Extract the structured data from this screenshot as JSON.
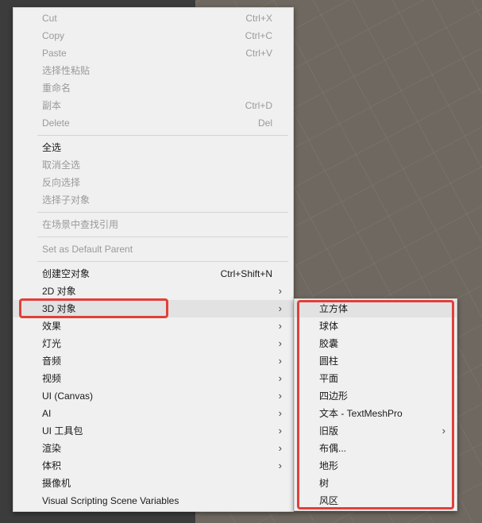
{
  "main_menu": {
    "group1": [
      {
        "label": "Cut",
        "shortcut": "Ctrl+X",
        "disabled": true
      },
      {
        "label": "Copy",
        "shortcut": "Ctrl+C",
        "disabled": true
      },
      {
        "label": "Paste",
        "shortcut": "Ctrl+V",
        "disabled": true
      },
      {
        "label": "选择性粘贴",
        "shortcut": "",
        "disabled": true
      },
      {
        "label": "重命名",
        "shortcut": "",
        "disabled": true
      },
      {
        "label": "副本",
        "shortcut": "Ctrl+D",
        "disabled": true
      },
      {
        "label": "Delete",
        "shortcut": "Del",
        "disabled": true
      }
    ],
    "group2": [
      {
        "label": "全选",
        "disabled": false
      },
      {
        "label": "取消全选",
        "disabled": true
      },
      {
        "label": "反向选择",
        "disabled": true
      },
      {
        "label": "选择子对象",
        "disabled": true
      }
    ],
    "group3": [
      {
        "label": "在场景中查找引用",
        "disabled": true
      }
    ],
    "group4": [
      {
        "label": "Set as Default Parent",
        "disabled": true
      }
    ],
    "group5": [
      {
        "label": "创建空对象",
        "shortcut": "Ctrl+Shift+N",
        "arrow": false
      },
      {
        "label": "2D 对象",
        "shortcut": "",
        "arrow": true
      },
      {
        "label": "3D 对象",
        "shortcut": "",
        "arrow": true,
        "highlighted": true
      },
      {
        "label": "效果",
        "shortcut": "",
        "arrow": true
      },
      {
        "label": "灯光",
        "shortcut": "",
        "arrow": true
      },
      {
        "label": "音频",
        "shortcut": "",
        "arrow": true
      },
      {
        "label": "视频",
        "shortcut": "",
        "arrow": true
      },
      {
        "label": "UI (Canvas)",
        "shortcut": "",
        "arrow": true
      },
      {
        "label": "AI",
        "shortcut": "",
        "arrow": true
      },
      {
        "label": "UI 工具包",
        "shortcut": "",
        "arrow": true
      },
      {
        "label": "渲染",
        "shortcut": "",
        "arrow": true
      },
      {
        "label": "体积",
        "shortcut": "",
        "arrow": true
      },
      {
        "label": "摄像机",
        "shortcut": "",
        "arrow": false
      },
      {
        "label": "Visual Scripting Scene Variables",
        "shortcut": "",
        "arrow": false
      }
    ]
  },
  "sub_menu": {
    "items": [
      {
        "label": "立方体",
        "arrow": false,
        "highlighted": true
      },
      {
        "label": "球体",
        "arrow": false
      },
      {
        "label": "胶囊",
        "arrow": false
      },
      {
        "label": "圆柱",
        "arrow": false
      },
      {
        "label": "平面",
        "arrow": false
      },
      {
        "label": "四边形",
        "arrow": false
      },
      {
        "label": "文本 - TextMeshPro",
        "arrow": false
      },
      {
        "label": "旧版",
        "arrow": true
      },
      {
        "label": "布偶...",
        "arrow": false
      },
      {
        "label": "地形",
        "arrow": false
      },
      {
        "label": "树",
        "arrow": false
      },
      {
        "label": "风区",
        "arrow": false
      }
    ]
  },
  "icons": {
    "submenu_arrow": "chevron-right-icon"
  },
  "colors": {
    "annotation": "#e0403a",
    "menu_bg": "#f0f0f0",
    "disabled_text": "#9a9a9a"
  }
}
